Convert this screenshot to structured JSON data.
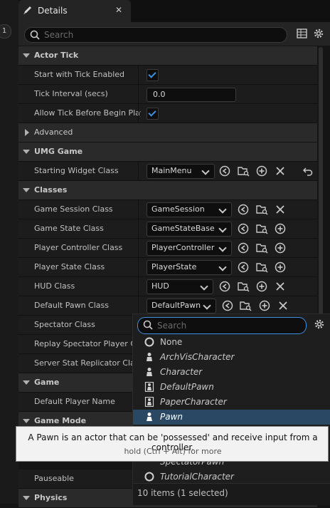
{
  "sidebar_badge": "1",
  "tab": {
    "title": "Details"
  },
  "search": {
    "placeholder": "Search"
  },
  "categories": {
    "actor_tick": "Actor Tick",
    "advanced": "Advanced",
    "umg_game": "UMG Game",
    "classes": "Classes",
    "game": "Game",
    "game_mode": "Game Mode",
    "physics": "Physics"
  },
  "props": {
    "start_tick": "Start with Tick Enabled",
    "tick_interval": "Tick Interval (secs)",
    "tick_interval_value": "0.0",
    "allow_tick": "Allow Tick Before Begin Play",
    "starting_widget": "Starting Widget Class",
    "starting_widget_value": "MainMenu",
    "game_session": "Game Session Class",
    "game_session_value": "GameSession",
    "game_state": "Game State Class",
    "game_state_value": "GameStateBase",
    "player_controller": "Player Controller Class",
    "player_controller_value": "PlayerController",
    "player_state": "Player State Class",
    "player_state_value": "PlayerState",
    "hud": "HUD Class",
    "hud_value": "HUD",
    "default_pawn": "Default Pawn Class",
    "default_pawn_value": "DefaultPawn",
    "spectator": "Spectator Class",
    "replay_spectator": "Replay Spectator Player Co",
    "server_stat": "Server Stat Replicator Clas",
    "default_player_name": "Default Player Name",
    "pauseable": "Pauseable"
  },
  "picker": {
    "placeholder": "Search",
    "items": [
      "None",
      "ArchVisCharacter",
      "Character",
      "DefaultPawn",
      "PaperCharacter",
      "Pawn",
      "SpectatorPawn",
      "TutorialCharacter"
    ],
    "selected": "Pawn",
    "footer": "10 items (1 selected)"
  },
  "tooltip": {
    "text": "A Pawn is an actor that can be 'possessed' and receive input from a controller.",
    "hint": "hold (Ctrl + Alt) for more"
  },
  "colors": {
    "accent": "#3d8fe6",
    "selection": "#2a4863",
    "tooltip_bg": "#f2f2f2"
  }
}
